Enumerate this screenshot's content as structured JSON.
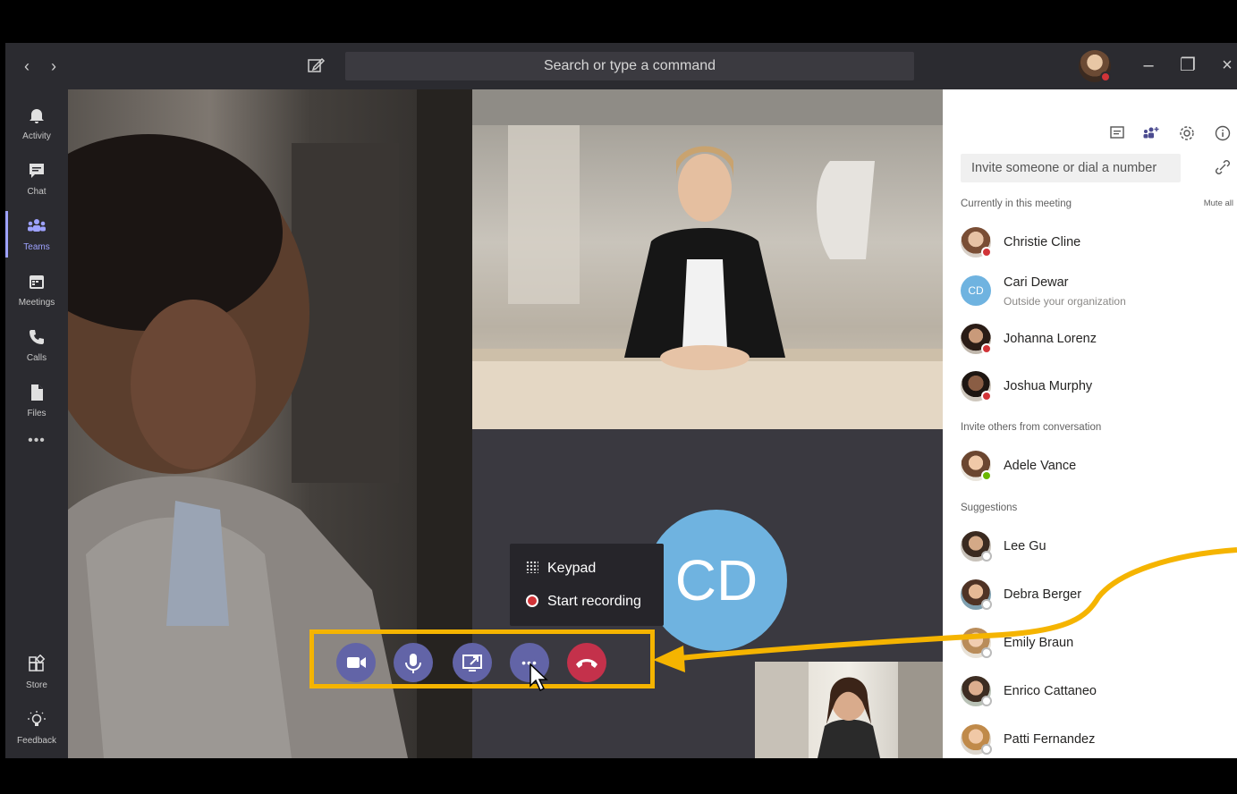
{
  "titlebar": {
    "search_placeholder": "Search or type a command",
    "back_icon": "‹",
    "forward_icon": "›",
    "minimize_icon": "–",
    "maximize_icon": "❐",
    "close_icon": "×"
  },
  "rail": {
    "items": [
      {
        "label": "Activity",
        "icon": "bell-icon"
      },
      {
        "label": "Chat",
        "icon": "chat-icon"
      },
      {
        "label": "Teams",
        "icon": "teams-icon"
      },
      {
        "label": "Meetings",
        "icon": "calendar-icon"
      },
      {
        "label": "Calls",
        "icon": "phone-icon"
      },
      {
        "label": "Files",
        "icon": "file-icon"
      },
      {
        "label": "Store",
        "icon": "store-icon"
      },
      {
        "label": "Feedback",
        "icon": "lightbulb-icon"
      }
    ],
    "more_label": "•••"
  },
  "call": {
    "participant_initials": "CD",
    "menu": {
      "keypad": "Keypad",
      "start_recording": "Start recording"
    },
    "more_glyph": "•••"
  },
  "panel": {
    "invite_placeholder": "Invite someone or dial a number",
    "current_label": "Currently in this meeting",
    "mute_all": "Mute all",
    "invite_others_label": "Invite others from conversation",
    "suggestions_label": "Suggestions",
    "in_meeting": [
      {
        "name": "Christie Cline",
        "sub": "",
        "status": "#d13438"
      },
      {
        "name": "Cari Dewar",
        "sub": "Outside your organization",
        "initials": "CD"
      },
      {
        "name": "Johanna Lorenz",
        "sub": "",
        "status": "#d13438"
      },
      {
        "name": "Joshua Murphy",
        "sub": "",
        "status": "#d13438"
      }
    ],
    "from_conversation": [
      {
        "name": "Adele Vance",
        "status": "#6bb700"
      }
    ],
    "suggestions": [
      {
        "name": "Lee Gu"
      },
      {
        "name": "Debra Berger"
      },
      {
        "name": "Emily Braun"
      },
      {
        "name": "Enrico Cattaneo"
      },
      {
        "name": "Patti Fernandez"
      }
    ]
  },
  "colors": {
    "accent": "#6264a7",
    "hangup": "#c4314b",
    "highlight": "#f5b400",
    "busy": "#d13438",
    "available": "#6bb700"
  }
}
